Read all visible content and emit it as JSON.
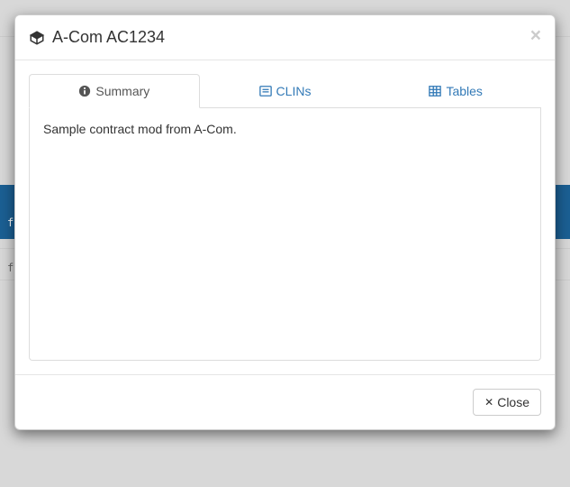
{
  "modal": {
    "title": "A-Com AC1234",
    "close_x": "×"
  },
  "tabs": {
    "summary": "Summary",
    "clins": "CLINs",
    "tables": "Tables"
  },
  "content": {
    "summary_text": "Sample contract mod from A-Com."
  },
  "footer": {
    "close_label": "Close"
  },
  "bg": {
    "frag1": "fr",
    "frag2": "fr"
  }
}
